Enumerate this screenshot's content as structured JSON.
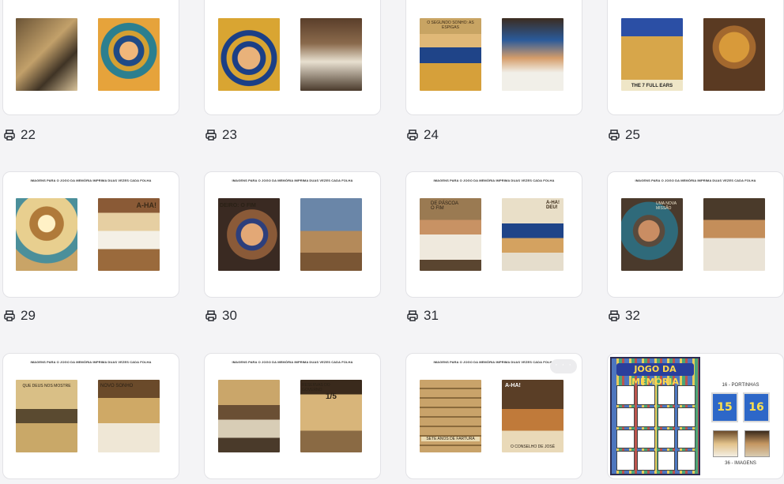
{
  "pages": [
    {
      "number": "22"
    },
    {
      "number": "23"
    },
    {
      "number": "24"
    },
    {
      "number": "25"
    },
    {
      "number": "29"
    },
    {
      "number": "30"
    },
    {
      "number": "31"
    },
    {
      "number": "32"
    }
  ],
  "card_heading": "IMAGENS PARA O JOGO DA MEMÓRIA IMPRIMA DUAS VEZES CADA FOLHA",
  "thumb_texts": {
    "t24a": "O SEGUNDO SONHO: AS ESPIGAS",
    "t25a": "THE 7 FULL EARS",
    "t29b": "A-HA!",
    "t30a": "DEIRO: O FIM",
    "t31a": "DE PÁSCOA O FIM",
    "t31b": "A-HA! DEU!",
    "t32a": "UMA NOVA MISSÃO",
    "t33a": "QUE DEUS NOS MOSTRE",
    "t33b": "NOVO SONHO",
    "t34b": "1/5",
    "t34b_title": "RESERVAS DO GOVERNO",
    "t35a": "SETE ANOS DE FARTURA",
    "t35b": "A-HA!",
    "t35b_foot": "O CONSELHO DE JOSÉ"
  },
  "more_button": "· · ·",
  "game_card": {
    "title": "JOGO DA MEMÓRIA",
    "doors_caption": "16 - PORTINHAS",
    "door_a": "15",
    "door_b": "16",
    "images_caption": "36 - IMAGENS"
  }
}
